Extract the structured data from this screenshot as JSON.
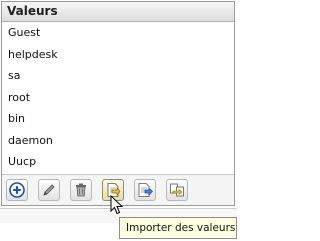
{
  "panel": {
    "title": "Valeurs",
    "items": [
      "Guest",
      "helpdesk",
      "sa",
      "root",
      "bin",
      "daemon",
      "Uucp"
    ]
  },
  "toolbar": {
    "buttons": [
      {
        "icon": "add-icon",
        "label": "Ajouter"
      },
      {
        "icon": "edit-icon",
        "label": "Modifier"
      },
      {
        "icon": "trash-icon",
        "label": "Supprimer"
      },
      {
        "icon": "import-icon",
        "label": "Importer des valeurs"
      },
      {
        "icon": "export-icon",
        "label": "Exporter"
      },
      {
        "icon": "move-icon",
        "label": "Déplacer"
      }
    ]
  },
  "tooltip": {
    "text": "Importer des valeurs"
  },
  "colors": {
    "accent": "#1a4fb8",
    "tooltip_bg": "#ffffe1",
    "folder": "#e7c34a"
  }
}
